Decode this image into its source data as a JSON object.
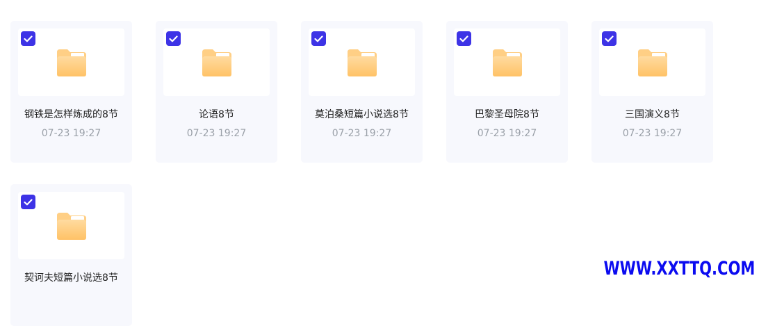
{
  "folders": [
    {
      "name": "钢铁是怎样炼成的8节",
      "date": "07-23 19:27",
      "checked": true
    },
    {
      "name": "论语8节",
      "date": "07-23 19:27",
      "checked": true
    },
    {
      "name": "莫泊桑短篇小说选8节",
      "date": "07-23 19:27",
      "checked": true
    },
    {
      "name": "巴黎圣母院8节",
      "date": "07-23 19:27",
      "checked": true
    },
    {
      "name": "三国演义8节",
      "date": "07-23 19:27",
      "checked": true
    },
    {
      "name": "契诃夫短篇小说选8节",
      "date": "",
      "checked": true
    }
  ],
  "watermark": "WWW.XXTTQ.COM",
  "colors": {
    "checkbox": "#3d33e6",
    "card_bg": "#f7f8fd",
    "folder_top": "#ffd998",
    "folder_bottom": "#ffc46d"
  }
}
